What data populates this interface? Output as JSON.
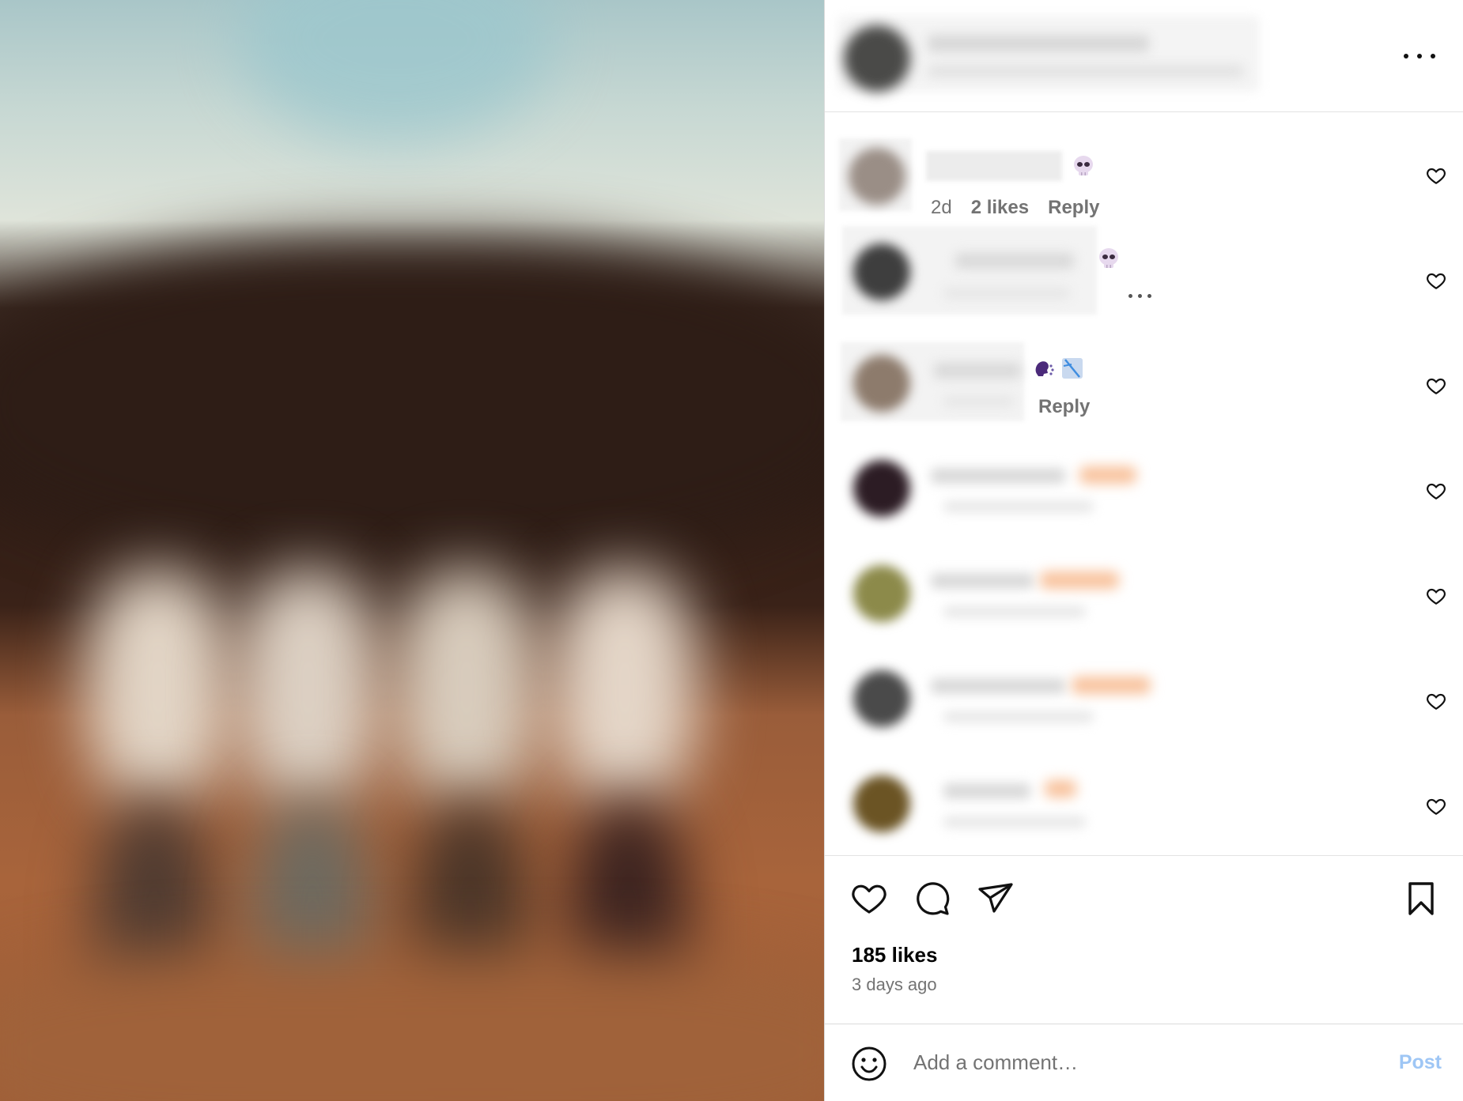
{
  "post": {
    "more_label": "More options"
  },
  "comments": [
    {
      "time": "2d",
      "likes": "2 likes",
      "reply": "Reply"
    },
    {
      "time": "",
      "likes": "",
      "reply": ""
    },
    {
      "time": "",
      "likes": "",
      "reply": "Reply"
    },
    {
      "time": "",
      "likes": "",
      "reply": ""
    },
    {
      "time": "",
      "likes": "",
      "reply": ""
    },
    {
      "time": "",
      "likes": "",
      "reply": ""
    },
    {
      "time": "",
      "likes": "",
      "reply": ""
    }
  ],
  "actions": {
    "like_icon": "heart-icon",
    "comment_icon": "comment-icon",
    "share_icon": "share-icon",
    "save_icon": "bookmark-icon"
  },
  "stats": {
    "likes": "185 likes",
    "time_ago": "3 days ago"
  },
  "composer": {
    "placeholder": "Add a comment…",
    "post_label": "Post"
  },
  "colors": {
    "accent_disabled": "#9ec6f5",
    "secondary_text": "#737373",
    "border": "#dbdbdb"
  }
}
